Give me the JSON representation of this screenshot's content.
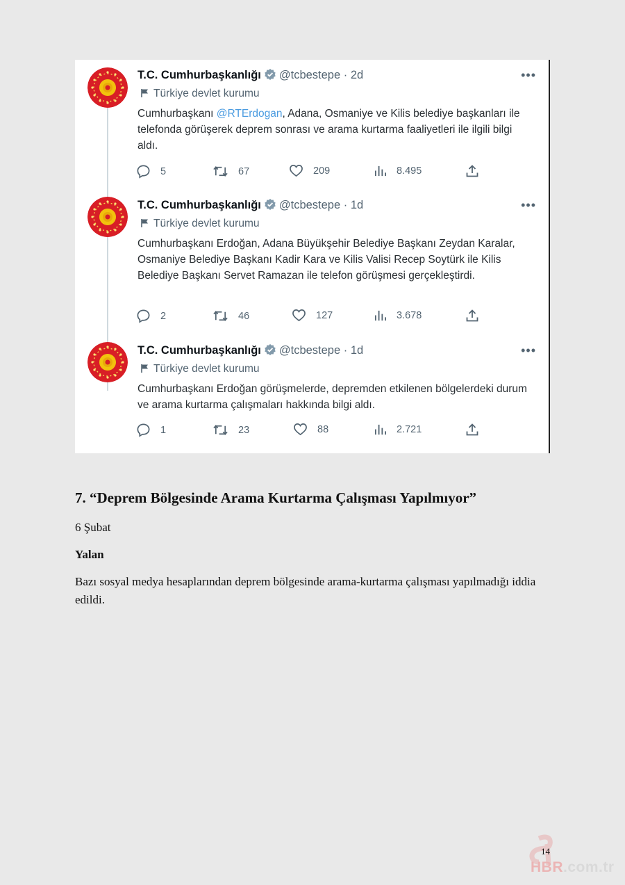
{
  "tweets": [
    {
      "name": "T.C. Cumhurbaşkanlığı",
      "handle": "@tcbestepe",
      "dot": "·",
      "age": "2d",
      "more": "•••",
      "label": "Türkiye devlet kurumu",
      "text_parts": [
        "Cumhurbaşkanı ",
        "@RTErdogan",
        ", Adana, Osmaniye ve Kilis belediye başkanları ile telefonda görüşerek deprem sonrası ve arama kurtarma faaliyetleri ile ilgili bilgi aldı."
      ],
      "replies": "5",
      "retweets": "67",
      "likes": "209",
      "views": "8.495"
    },
    {
      "name": "T.C. Cumhurbaşkanlığı",
      "handle": "@tcbestepe",
      "dot": "·",
      "age": "1d",
      "more": "•••",
      "label": "Türkiye devlet kurumu",
      "text": "Cumhurbaşkanı Erdoğan, Adana Büyükşehir Belediye Başkanı Zeydan Karalar, Osmaniye Belediye Başkanı Kadir Kara ve Kilis Valisi Recep Soytürk ile Kilis Belediye Başkanı Servet Ramazan ile telefon görüşmesi gerçekleştirdi.",
      "replies": "2",
      "retweets": "46",
      "likes": "127",
      "views": "3.678"
    },
    {
      "name": "T.C. Cumhurbaşkanlığı",
      "handle": "@tcbestepe",
      "dot": "·",
      "age": "1d",
      "more": "•••",
      "label": "Türkiye devlet kurumu",
      "text": "Cumhurbaşkanı Erdoğan görüşmelerde, depremden etkilenen bölgelerdeki durum ve arama kurtarma çalışmaları hakkında bilgi aldı.",
      "replies": "1",
      "retweets": "23",
      "likes": "88",
      "views": "2.721"
    }
  ],
  "section": {
    "heading": "7.  “Deprem Bölgesinde Arama Kurtarma Çalışması Yapılmıyor”",
    "date": "6 Şubat",
    "verdict": "Yalan",
    "paragraph": "Bazı sosyal medya hesaplarından deprem bölgesinde arama-kurtarma çalışması yapılmadığı iddia edildi."
  },
  "page_number": "14",
  "watermark": {
    "letter": "a",
    "brand": "HBR",
    "domain": ".com.tr"
  },
  "colors": {
    "mention": "#4a9be0",
    "muted": "#536471",
    "emblem_red": "#d81e26",
    "emblem_gold": "#f2c20d",
    "verified": "#829aab"
  },
  "icons": [
    "flag-icon",
    "verified-badge-icon",
    "reply-icon",
    "retweet-icon",
    "like-icon",
    "views-icon",
    "share-icon"
  ]
}
